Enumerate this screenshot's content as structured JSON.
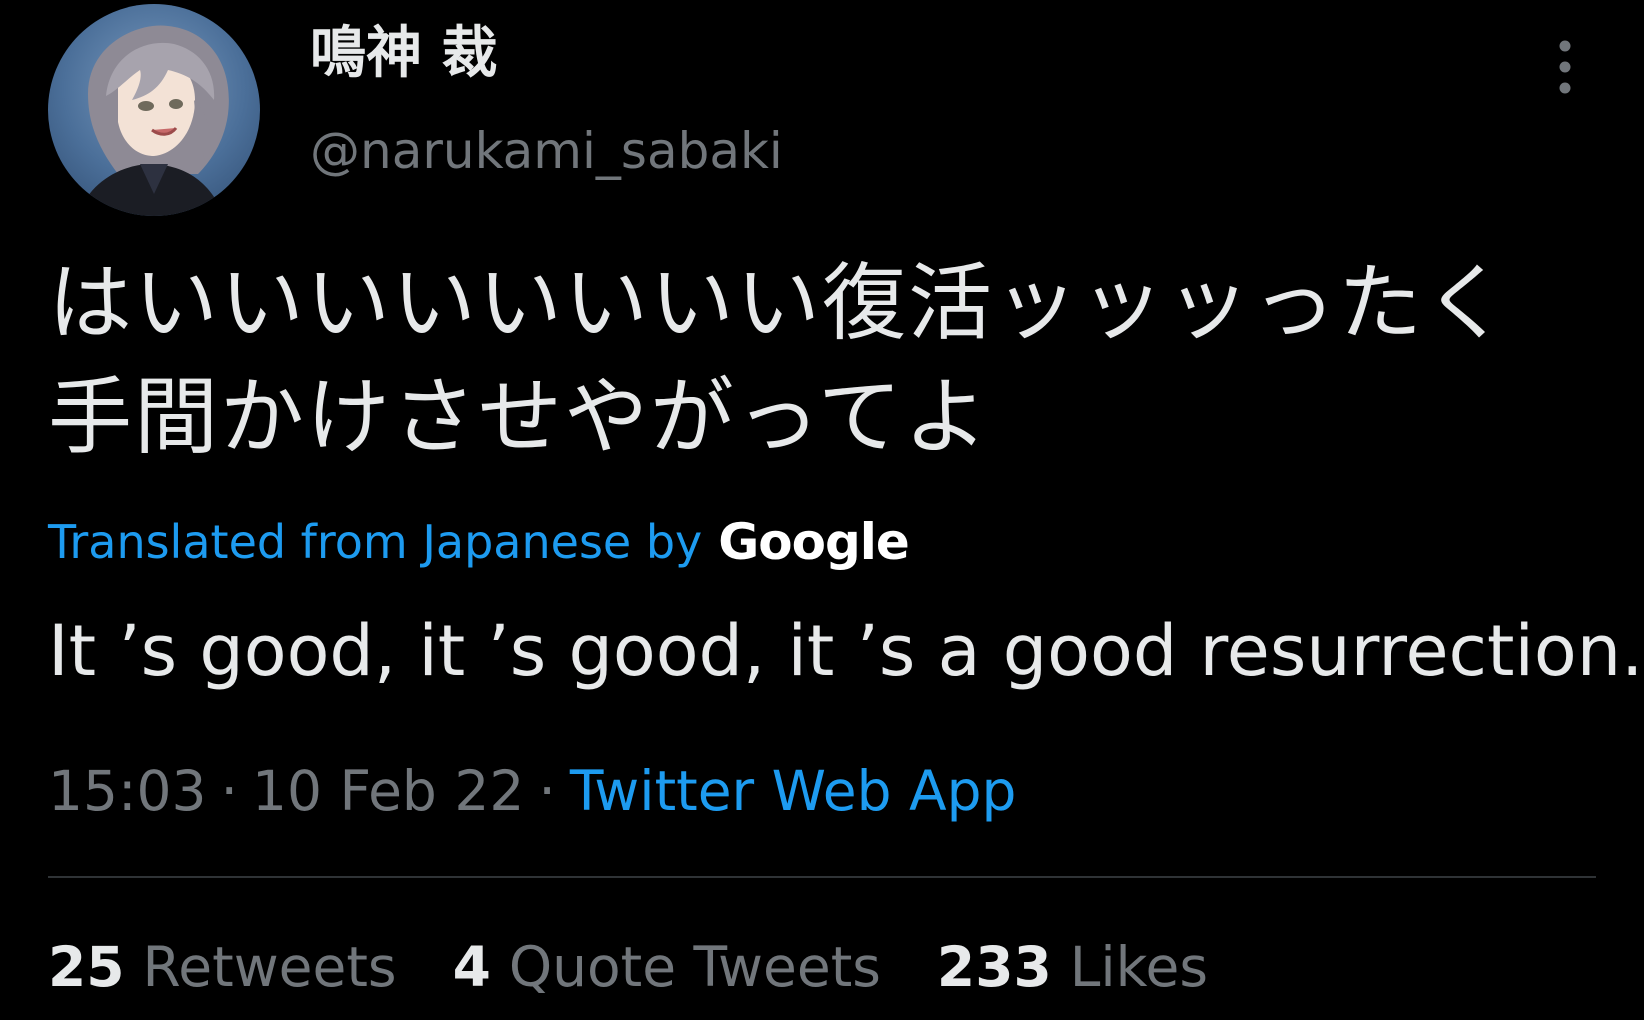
{
  "author": {
    "display_name": "鳴神 裁",
    "handle": "@narukami_sabaki",
    "avatar_icon": "profile-avatar-image"
  },
  "tweet": {
    "text_lines": [
      "はいいいいいいいい復活ッッッったく",
      "手間かけさせやがってよ"
    ],
    "translated_label": "Translated from Japanese by",
    "translator_brand": "Google",
    "translation": "It ’s good, it ’s good, it ’s a good resurrection."
  },
  "meta": {
    "time": "15:03",
    "separator": "·",
    "date": "10 Feb 22",
    "source": "Twitter Web App"
  },
  "stats": [
    {
      "count": "25",
      "label": "Retweets"
    },
    {
      "count": "4",
      "label": "Quote Tweets"
    },
    {
      "count": "233",
      "label": "Likes"
    }
  ],
  "icons": {
    "more": "more-vertical-icon"
  },
  "colors": {
    "background": "#000000",
    "text_primary": "#e7e9ea",
    "text_secondary": "#71767b",
    "link": "#1d9bf0",
    "divider": "#2f3336"
  }
}
